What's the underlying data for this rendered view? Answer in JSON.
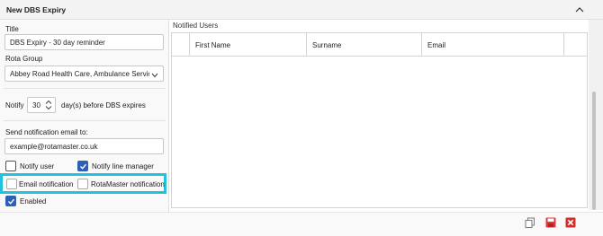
{
  "panel": {
    "title": "New DBS Expiry"
  },
  "form": {
    "title_label": "Title",
    "title_value": "DBS Expiry - 30 day reminder",
    "rota_group_label": "Rota Group",
    "rota_group_value": "Abbey Road Health Care, Ambulance Servic...",
    "notify_prefix": "Notify",
    "notify_days": "30",
    "notify_suffix": "day(s) before DBS expires",
    "email_label": "Send notification email to:",
    "email_placeholder": "example@rotamaster.co.uk",
    "notify_user_label": "Notify user",
    "notify_user_checked": false,
    "notify_line_manager_label": "Notify line manager",
    "notify_line_manager_checked": true,
    "email_notification_label": "Email notification",
    "email_notification_checked": false,
    "rotamaster_notification_label": "RotaMaster notification",
    "rotamaster_notification_checked": false,
    "enabled_label": "Enabled",
    "enabled_checked": true
  },
  "notified_users": {
    "label": "Notified Users",
    "columns": [
      "First Name",
      "Surname",
      "Email"
    ],
    "rows": []
  },
  "colors": {
    "accent": "#2c5fb8",
    "highlight": "#22c2dc",
    "delete": "#d0312d"
  },
  "icons": [
    "chevron-up-icon",
    "chevron-down-icon",
    "spinner-icon",
    "copy-icon",
    "save-icon",
    "delete-icon"
  ]
}
